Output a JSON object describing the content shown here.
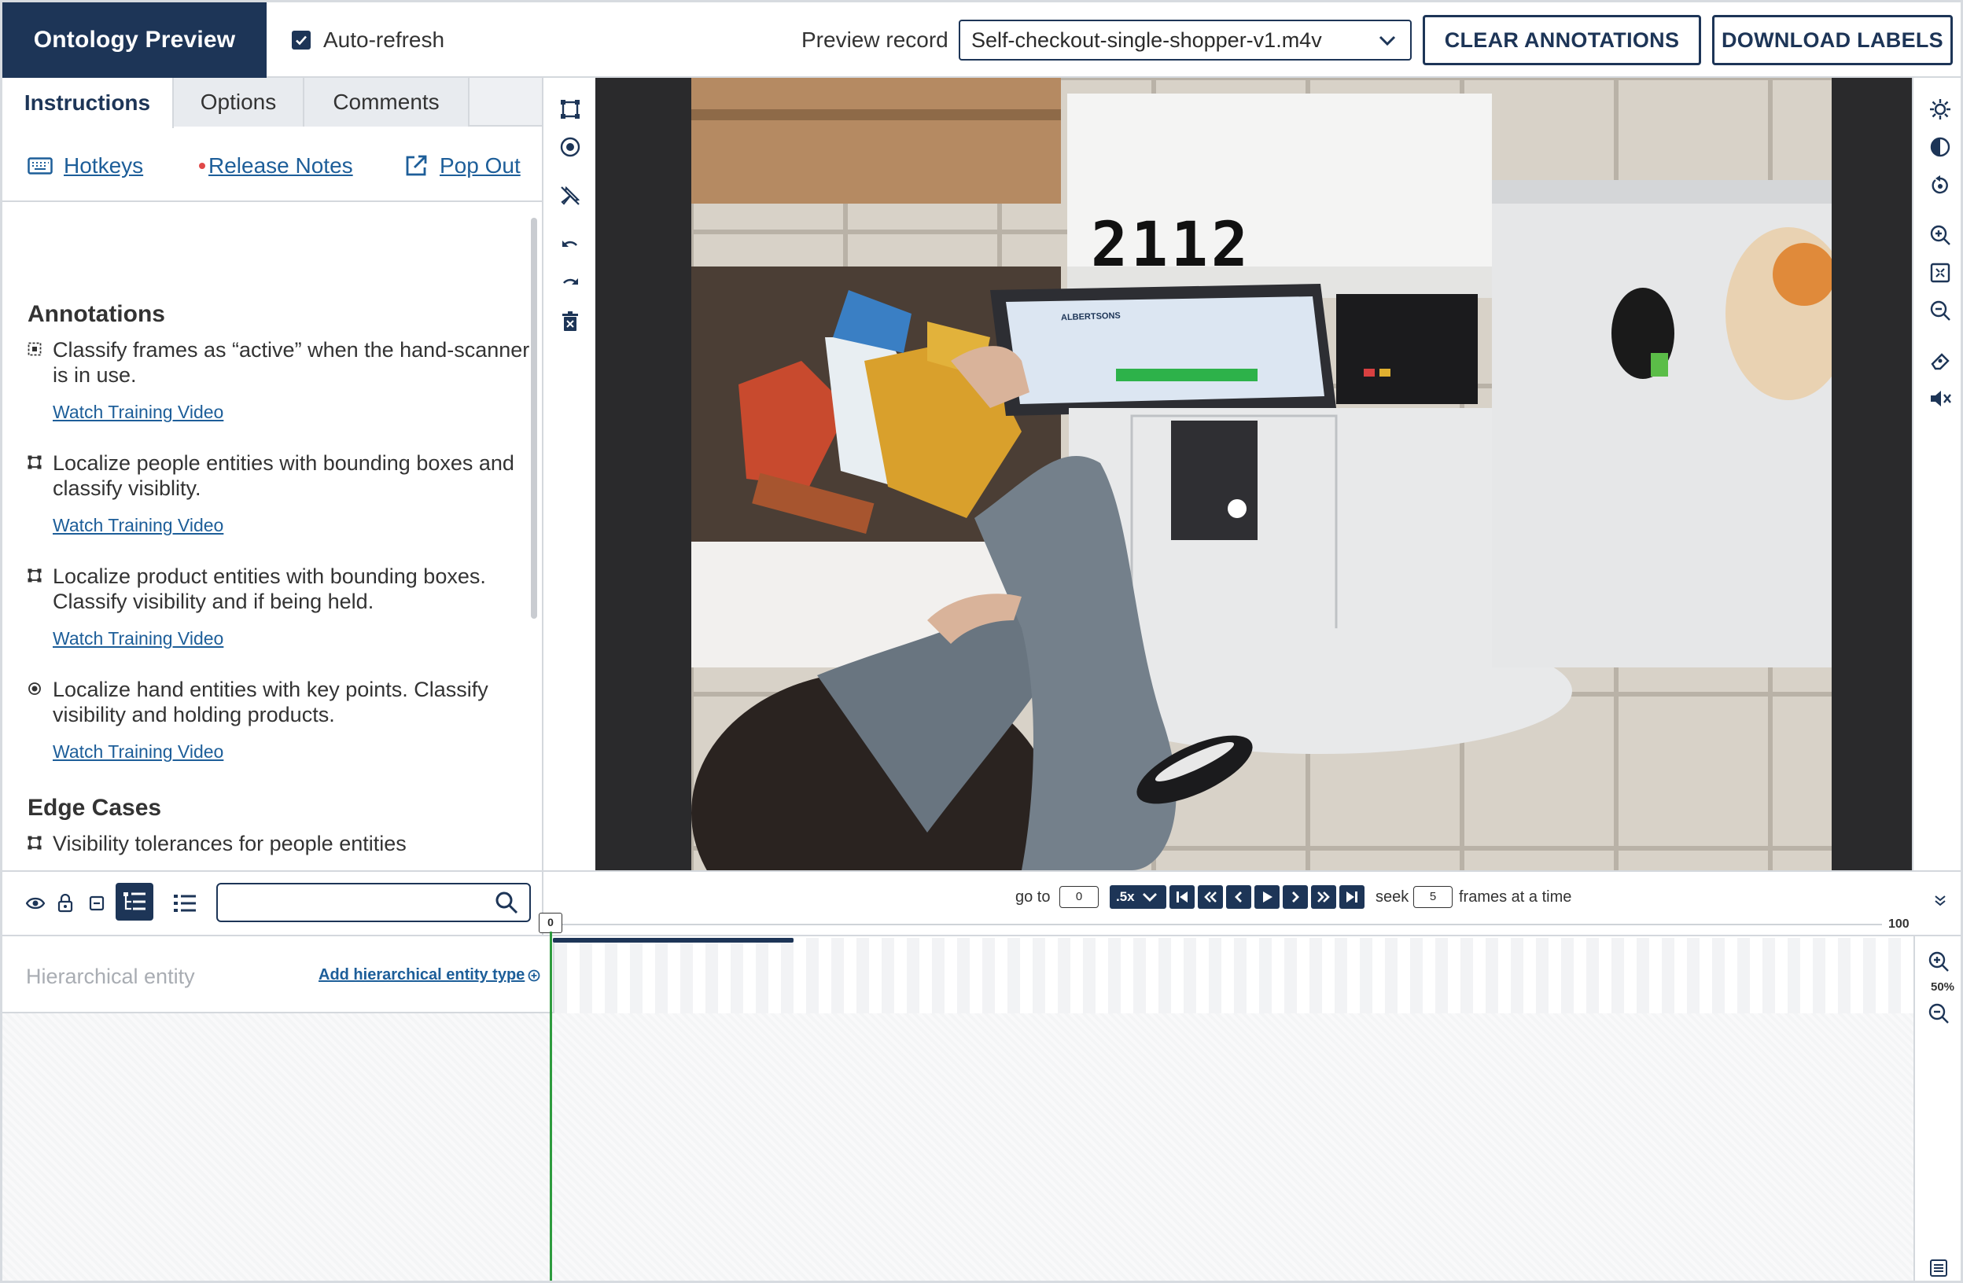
{
  "header": {
    "title": "Ontology Preview",
    "auto_refresh_label": "Auto-refresh",
    "auto_refresh_checked": true,
    "preview_label": "Preview record",
    "preview_value": "Self-checkout-single-shopper-v1.m4v",
    "clear_button": "CLEAR ANNOTATIONS",
    "download_button": "DOWNLOAD LABELS"
  },
  "tabs": [
    {
      "label": "Instructions",
      "active": true
    },
    {
      "label": "Options",
      "active": false
    },
    {
      "label": "Comments",
      "active": false
    }
  ],
  "links": {
    "hotkeys": "Hotkeys",
    "release_notes": "Release Notes",
    "pop_out": "Pop Out"
  },
  "instructions": {
    "annotations_heading": "Annotations",
    "items": [
      {
        "icon": "frame-classification-icon",
        "text": "Classify frames as “active” when the hand-scanner is in use.",
        "link": "Watch Training Video"
      },
      {
        "icon": "bounding-box-icon",
        "text": "Localize people entities with bounding boxes and classify visiblity.",
        "link": "Watch Training Video"
      },
      {
        "icon": "bounding-box-icon",
        "text": "Localize product entities with bounding boxes. Classify visibility and if being held.",
        "link": "Watch Training Video"
      },
      {
        "icon": "keypoint-icon",
        "text": "Localize hand entities with key points. Classify visibility and holding products.",
        "link": "Watch Training Video"
      }
    ],
    "edge_heading": "Edge Cases",
    "edge_items": [
      {
        "icon": "bounding-box-icon",
        "text": "Visibility tolerances for people entities"
      }
    ],
    "thumbnail_number": "2112"
  },
  "video": {
    "box_number": "2112",
    "kiosk_brand": "ALBERTSONS"
  },
  "player": {
    "goto_label": "go to",
    "goto_value": "0",
    "speed": ".5x",
    "seek_label": "seek",
    "seek_value": "5",
    "seek_suffix": "frames at a time",
    "timeline_start": "0",
    "timeline_end": "100",
    "progress_fraction": 0.18,
    "zoom": "50%"
  },
  "entities": {
    "search_placeholder": "",
    "row_label": "Hierarchical entity",
    "add_label": "Add hierarchical entity type"
  },
  "colors": {
    "brand": "#1d3557",
    "link": "#1d5e99",
    "playhead": "#2e9b3e"
  }
}
